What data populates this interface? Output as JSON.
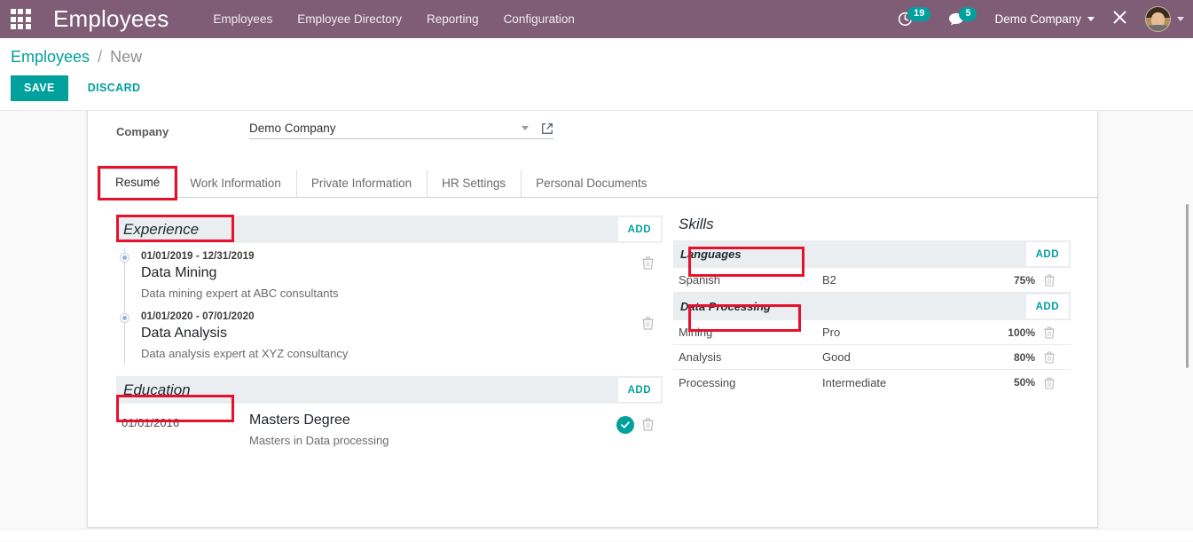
{
  "navbar": {
    "apps_icon": "apps-grid-icon",
    "brand": "Employees",
    "menu": [
      {
        "label": "Employees"
      },
      {
        "label": "Employee Directory"
      },
      {
        "label": "Reporting"
      },
      {
        "label": "Configuration"
      }
    ],
    "activities": {
      "icon": "clock-icon",
      "count": "19"
    },
    "messages": {
      "icon": "chat-bubble-icon",
      "count": "5"
    },
    "company": "Demo Company",
    "tools_icon": "wrench-cross-icon",
    "avatar": "user-avatar"
  },
  "control_panel": {
    "breadcrumb_root": "Employees",
    "breadcrumb_sep": "/",
    "breadcrumb_current": "New",
    "save_label": "SAVE",
    "discard_label": "DISCARD"
  },
  "form": {
    "company_label": "Company",
    "company_value": "Demo Company",
    "company_placeholder": "Company"
  },
  "tabs": [
    {
      "label": "Resumé",
      "active": true,
      "highlighted": true
    },
    {
      "label": "Work Information",
      "active": false,
      "highlighted": false
    },
    {
      "label": "Private Information",
      "active": false,
      "highlighted": false
    },
    {
      "label": "HR Settings",
      "active": false,
      "highlighted": false
    },
    {
      "label": "Personal Documents",
      "active": false,
      "highlighted": false
    }
  ],
  "resume": {
    "experience": {
      "title": "Experience",
      "add_label": "ADD",
      "entries": [
        {
          "date": "01/01/2019 - 12/31/2019",
          "name": "Data Mining",
          "description": "Data mining expert at ABC consultants",
          "delete_icon": "trash-icon"
        },
        {
          "date": "01/01/2020 - 07/01/2020",
          "name": "Data Analysis",
          "description": "Data analysis expert at XYZ consultancy",
          "delete_icon": "trash-icon"
        }
      ]
    },
    "education": {
      "title": "Education",
      "add_label": "ADD",
      "entries": [
        {
          "date": "01/01/2016",
          "name": "Masters Degree",
          "description": "Masters in Data processing",
          "confirm_icon": "check-circle-icon",
          "delete_icon": "trash-icon"
        }
      ]
    }
  },
  "skills": {
    "title": "Skills",
    "groups": [
      {
        "name": "Languages",
        "add_label": "ADD",
        "highlighted": true,
        "rows": [
          {
            "skill": "Spanish",
            "level": "B2",
            "progress": "75%",
            "progress_value": 75
          }
        ]
      },
      {
        "name": "Data Processing",
        "add_label": "ADD",
        "highlighted": true,
        "rows": [
          {
            "skill": "Mining",
            "level": "Pro",
            "progress": "100%",
            "progress_value": 100
          },
          {
            "skill": "Analysis",
            "level": "Good",
            "progress": "80%",
            "progress_value": 80
          },
          {
            "skill": "Processing",
            "level": "Intermediate",
            "progress": "50%",
            "progress_value": 50
          }
        ]
      }
    ]
  },
  "colors": {
    "navbar": "#7f5d77",
    "accent": "#00a09d",
    "progress": "#0a9b96",
    "highlight": "#e8112d",
    "section_header": "#eaeef0",
    "page_bg": "#f9f9f9"
  }
}
